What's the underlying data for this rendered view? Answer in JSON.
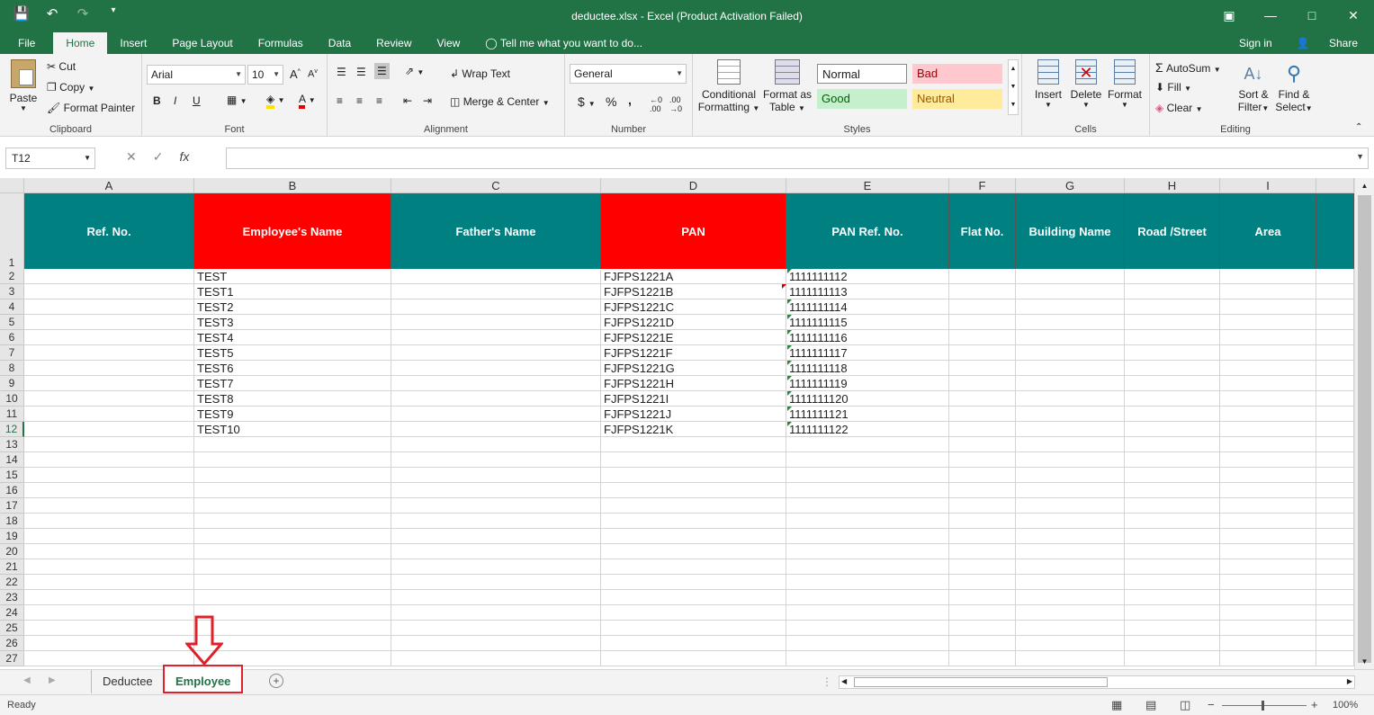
{
  "title": "deductee.xlsx - Excel (Product Activation Failed)",
  "qat": {
    "save": "save-icon",
    "undo": "undo-icon",
    "redo": "redo-icon",
    "customize": "customize-icon"
  },
  "tabs": [
    "File",
    "Home",
    "Insert",
    "Page Layout",
    "Formulas",
    "Data",
    "Review",
    "View"
  ],
  "tell_me": "Tell me what you want to do...",
  "sign_in": "Sign in",
  "share": "Share",
  "clipboard": {
    "paste": "Paste",
    "cut": "Cut",
    "copy": "Copy",
    "format_painter": "Format Painter",
    "label": "Clipboard"
  },
  "font": {
    "name": "Arial",
    "size": "10",
    "label": "Font",
    "bold": "B",
    "italic": "I",
    "underline": "U"
  },
  "alignment": {
    "wrap_text": "Wrap Text",
    "merge_center": "Merge & Center",
    "label": "Alignment"
  },
  "number": {
    "format": "General",
    "label": "Number",
    "currency": "$",
    "percent": "%",
    "comma": ","
  },
  "styles": {
    "conditional": "Conditional",
    "conditional2": "Formatting",
    "format_as": "Format as",
    "format_as2": "Table",
    "normal": "Normal",
    "bad": "Bad",
    "good": "Good",
    "neutral": "Neutral",
    "label": "Styles"
  },
  "cells": {
    "insert": "Insert",
    "delete": "Delete",
    "format": "Format",
    "label": "Cells"
  },
  "editing": {
    "autosum": "AutoSum",
    "fill": "Fill",
    "clear": "Clear",
    "sort": "Sort &",
    "sort2": "Filter",
    "find": "Find &",
    "find2": "Select",
    "label": "Editing"
  },
  "name_box": "T12",
  "formula_icon": "fx",
  "columns": [
    "A",
    "B",
    "C",
    "D",
    "E",
    "F",
    "G",
    "H",
    "I"
  ],
  "headers": [
    "Ref. No.",
    "Employee's Name",
    "Father's Name",
    "PAN",
    "PAN Ref. No.",
    "Flat No.",
    "Building Name",
    "Road /Street",
    "Area"
  ],
  "rows": [
    {
      "num": "2",
      "name": "TEST",
      "pan": "FJFPS1221A",
      "ref": "1111111112"
    },
    {
      "num": "3",
      "name": "TEST1",
      "pan": "FJFPS1221B",
      "ref": "1111111113"
    },
    {
      "num": "4",
      "name": "TEST2",
      "pan": "FJFPS1221C",
      "ref": "1111111114"
    },
    {
      "num": "5",
      "name": "TEST3",
      "pan": "FJFPS1221D",
      "ref": "1111111115"
    },
    {
      "num": "6",
      "name": "TEST4",
      "pan": "FJFPS1221E",
      "ref": "1111111116"
    },
    {
      "num": "7",
      "name": "TEST5",
      "pan": "FJFPS1221F",
      "ref": "1111111117"
    },
    {
      "num": "8",
      "name": "TEST6",
      "pan": "FJFPS1221G",
      "ref": "1111111118"
    },
    {
      "num": "9",
      "name": "TEST7",
      "pan": "FJFPS1221H",
      "ref": "1111111119"
    },
    {
      "num": "10",
      "name": "TEST8",
      "pan": "FJFPS1221I",
      "ref": "1111111120"
    },
    {
      "num": "11",
      "name": "TEST9",
      "pan": "FJFPS1221J",
      "ref": "1111111121"
    },
    {
      "num": "12",
      "name": "TEST10",
      "pan": "FJFPS1221K",
      "ref": "1111111122"
    }
  ],
  "empty_rows": [
    "13",
    "14",
    "15",
    "16",
    "17",
    "18",
    "19",
    "20",
    "21",
    "22",
    "23",
    "24",
    "25",
    "26",
    "27"
  ],
  "sheets": [
    "Deductee",
    "Employee"
  ],
  "active_sheet": "Employee",
  "status": "Ready",
  "zoom": "100%",
  "colors": {
    "excel_green": "#217346",
    "teal": "#008080",
    "red": "#ff0000",
    "annotation": "#e0202a"
  }
}
